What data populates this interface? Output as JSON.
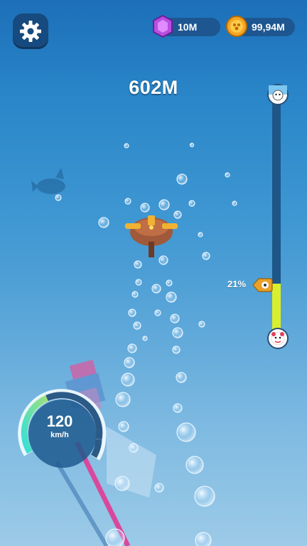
{
  "hud": {
    "gems": "10M",
    "coins": "99,94M",
    "distance": "602M"
  },
  "progress": {
    "percent_label": "21%",
    "fraction": 0.21
  },
  "speedometer": {
    "value": "120",
    "unit": "km/h"
  },
  "colors": {
    "water_top": "#1c6fb8",
    "water_bottom": "#8cc2e4",
    "progress_fill": "#d9ef2b",
    "gem": "#b84fe0",
    "coin": "#f5a623"
  },
  "icons": {
    "settings": "gear-icon",
    "gems": "gem-icon",
    "coins": "coin-icon"
  }
}
